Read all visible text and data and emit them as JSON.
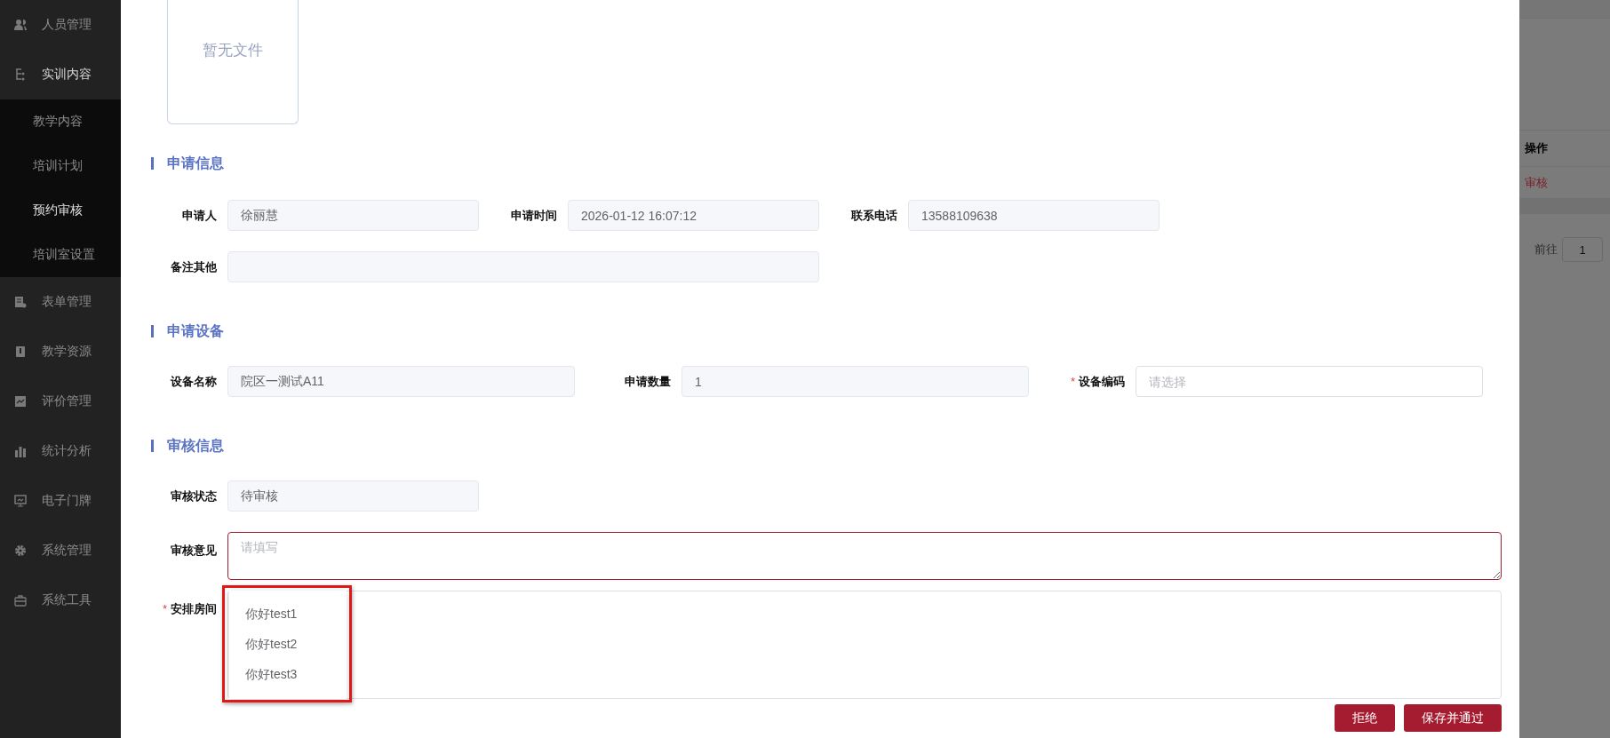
{
  "sidebar": {
    "items": [
      {
        "label": "人员管理",
        "selected": false
      },
      {
        "label": "实训内容",
        "selected": false,
        "expanded": true,
        "children": [
          {
            "label": "教学内容",
            "selected": false
          },
          {
            "label": "培训计划",
            "selected": false
          },
          {
            "label": "预约审核",
            "selected": true
          },
          {
            "label": "培训室设置",
            "selected": false
          }
        ]
      },
      {
        "label": "表单管理",
        "selected": false
      },
      {
        "label": "教学资源",
        "selected": false
      },
      {
        "label": "评价管理",
        "selected": false
      },
      {
        "label": "统计分析",
        "selected": false
      },
      {
        "label": "电子门牌",
        "selected": false
      },
      {
        "label": "系统管理",
        "selected": false
      },
      {
        "label": "系统工具",
        "selected": false
      }
    ]
  },
  "background_page": {
    "table": {
      "columns": [
        "操作"
      ],
      "rows": [
        [
          "审核"
        ]
      ]
    },
    "pagination": {
      "goto_label": "前往",
      "page": "1"
    }
  },
  "dialog": {
    "file_preview": {
      "text": "暂无文件"
    },
    "sections": [
      {
        "title": "申请信息",
        "fields": [
          {
            "label": "申请人",
            "kind": "readonly",
            "value": "徐丽慧"
          },
          {
            "label": "申请时间",
            "kind": "readonly",
            "value": "2026-01-12 16:07:12"
          },
          {
            "label": "联系电话",
            "kind": "readonly",
            "value": "13588109638"
          },
          {
            "label": "备注其他",
            "kind": "readonly"
          }
        ]
      },
      {
        "title": "申请设备",
        "fields": [
          {
            "label": "设备名称",
            "kind": "readonly",
            "value": "院区一测试A11"
          },
          {
            "label": "申请数量",
            "kind": "readonly",
            "value": "1"
          },
          {
            "label": "设备编码",
            "kind": "input",
            "placeholder": "请选择",
            "required_mark": "*"
          }
        ]
      },
      {
        "title": "审核信息",
        "fields": [
          {
            "label": "审核状态",
            "kind": "readonly",
            "value": "待审核"
          },
          {
            "label": "审核意见",
            "kind": "textarea",
            "placeholder": "请填写"
          },
          {
            "label": "安排房间",
            "kind": "select",
            "required_mark": "*",
            "options": [
              {
                "label": "你好test1",
                "selected": false
              },
              {
                "label": "你好test2",
                "selected": false
              },
              {
                "label": "你好test3",
                "selected": false
              }
            ]
          }
        ]
      }
    ],
    "buttons": [
      {
        "label": "拒绝"
      },
      {
        "label": "保存并通过"
      }
    ]
  }
}
